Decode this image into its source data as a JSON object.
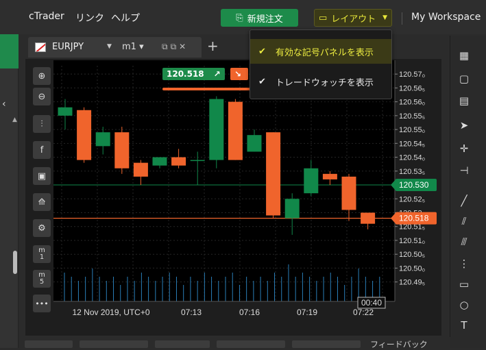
{
  "topbar": {
    "menu": [
      "cTrader",
      "リンク",
      "ヘルプ"
    ],
    "new_order": "新規注文",
    "layout": "レイアウト",
    "workspace": "My Workspace"
  },
  "tab": {
    "symbol": "EURJPY",
    "timeframe": "m1"
  },
  "dropdown": {
    "items": [
      {
        "label": "有効な記号パネルを表示",
        "checked": true,
        "highlighted": true
      },
      {
        "label": "トレードウォッチを表示",
        "checked": true,
        "highlighted": false
      }
    ]
  },
  "quote": {
    "buy_price": "120.518",
    "buy_color": "#1d8b4a",
    "sell_color": "#f0642c"
  },
  "left_tools": [
    "zoom-in-icon",
    "zoom-out-icon",
    "candles-icon",
    "facebook-icon",
    "robot-icon",
    "indicators-icon",
    "chart-settings-icon",
    "m1-timeframe",
    "m5-timeframe",
    "more-icon"
  ],
  "left_tool_labels": {
    "m1": "m",
    "m1_sub": "1",
    "m5": "m",
    "m5_sub": "5",
    "more": "•••"
  },
  "chart_data": {
    "type": "candlestick",
    "symbol": "EURJPY",
    "timeframe": "m1",
    "ylim": [
      120.488,
      120.573
    ],
    "y_ticks": [
      "120.570",
      "120.565",
      "120.560",
      "120.555",
      "120.550",
      "120.545",
      "120.540",
      "120.535",
      "120.525",
      "120.520",
      "120.515",
      "120.510",
      "120.505",
      "120.500",
      "120.495"
    ],
    "y_tick_display": [
      "120.57₀",
      "120.56₅",
      "120.56₀",
      "120.55₅",
      "120.55₀",
      "120.54₅",
      "120.54₀",
      "120.53₅",
      "120.52₅",
      "120.52",
      "120.51₅",
      "120.51₀",
      "120.50₅",
      "120.50₀",
      "120.49₅"
    ],
    "x_labels": [
      "12 Nov 2019, UTC+0",
      "07:13",
      "07:16",
      "07:19",
      "07:22"
    ],
    "cursor_time": "00:40",
    "bid_line": 120.518,
    "ask_line": 120.53,
    "bid_label": "120.518",
    "ask_label": "120.530",
    "bull_color": "#11884a",
    "bear_color": "#f0642c",
    "candles": [
      {
        "o": 120.555,
        "h": 120.561,
        "l": 120.55,
        "c": 120.558
      },
      {
        "o": 120.557,
        "h": 120.558,
        "l": 120.538,
        "c": 120.539
      },
      {
        "o": 120.544,
        "h": 120.551,
        "l": 120.541,
        "c": 120.549
      },
      {
        "o": 120.549,
        "h": 120.551,
        "l": 120.534,
        "c": 120.536
      },
      {
        "o": 120.538,
        "h": 120.539,
        "l": 120.53,
        "c": 120.533
      },
      {
        "o": 120.537,
        "h": 120.54,
        "l": 120.536,
        "c": 120.54
      },
      {
        "o": 120.54,
        "h": 120.543,
        "l": 120.536,
        "c": 120.537
      },
      {
        "o": 120.539,
        "h": 120.542,
        "l": 120.53,
        "c": 120.539
      },
      {
        "o": 120.539,
        "h": 120.562,
        "l": 120.536,
        "c": 120.561
      },
      {
        "o": 120.56,
        "h": 120.561,
        "l": 120.539,
        "c": 120.539
      },
      {
        "o": 120.542,
        "h": 120.55,
        "l": 120.542,
        "c": 120.548
      },
      {
        "o": 120.549,
        "h": 120.549,
        "l": 120.518,
        "c": 120.519
      },
      {
        "o": 120.518,
        "h": 120.527,
        "l": 120.512,
        "c": 120.525
      },
      {
        "o": 120.527,
        "h": 120.539,
        "l": 120.526,
        "c": 120.536
      },
      {
        "o": 120.534,
        "h": 120.535,
        "l": 120.53,
        "c": 120.532
      },
      {
        "o": 120.533,
        "h": 120.534,
        "l": 120.517,
        "c": 120.521
      },
      {
        "o": 120.52,
        "h": 120.52,
        "l": 120.514,
        "c": 120.516
      }
    ],
    "volumes": [
      0.35,
      0.3,
      0.25,
      0.3,
      0.4,
      0.3,
      0.25,
      0.3,
      0.2,
      0.3,
      0.25,
      0.35,
      0.3,
      0.25,
      0.3,
      0.35,
      0.3,
      0.2,
      0.3,
      0.25,
      0.35,
      0.3,
      0.25,
      0.3,
      0.35,
      0.2,
      0.3,
      0.25,
      0.3,
      0.25,
      0.35,
      0.3,
      0.45,
      0.3,
      0.35,
      0.3,
      0.25,
      0.3,
      0.35,
      0.3,
      0.2,
      0.3,
      0.4,
      0.3,
      0.25,
      0.3
    ]
  },
  "feedback": "フィードバック"
}
